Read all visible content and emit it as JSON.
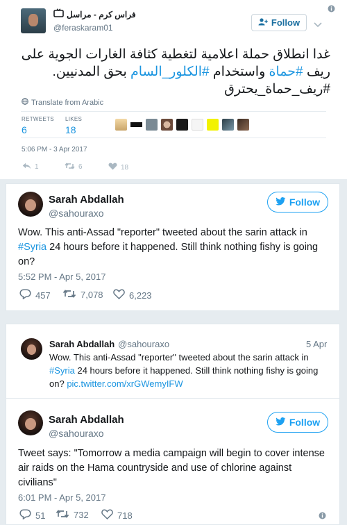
{
  "top_tweet": {
    "display_name": "فراس كرم - مراسل",
    "handle": "@feraskaram01",
    "follow_label": "Follow",
    "text_line1": "غدا انطلاق حملة اعلامية لتغطية كثافة الغارات الجوية على",
    "text_line2_a": "ريف ",
    "text_line2_hashtag1": "#حماة",
    "text_line2_b": " واستخدام ",
    "text_line2_hashtag2": "#الكلور_السام",
    "text_line2_c": " بحق المدنيين.",
    "text_line3_hashtag": "#ريف_حماة_يحترق",
    "translate_label": "Translate from Arabic",
    "retweets_label": "RETWEETS",
    "retweets_value": "6",
    "likes_label": "LIKES",
    "likes_value": "18",
    "timestamp": "5:06 PM - 3 Apr 2017",
    "reply_count": "1",
    "retweet_count": "6",
    "like_count": "18"
  },
  "tweet1": {
    "display_name": "Sarah Abdallah",
    "handle": "@sahouraxo",
    "follow_label": "Follow",
    "text_a": "Wow. This anti-Assad \"reporter\" tweeted about the sarin attack in ",
    "hashtag": "#Syria",
    "text_b": " 24 hours before it happened. Still think nothing fishy is going on?",
    "timestamp": "5:52 PM - Apr 5, 2017",
    "reply_count": "457",
    "retweet_count": "7,078",
    "like_count": "6,223"
  },
  "quoted": {
    "display_name": "Sarah Abdallah",
    "handle": "@sahouraxo",
    "date": "5 Apr",
    "text_a": "Wow. This anti-Assad \"reporter\" tweeted about the sarin attack in ",
    "hashtag": "#Syria",
    "text_b": " 24 hours before it happened. Still think nothing fishy is going on? ",
    "link": "pic.twitter.com/xrGWemyIFW"
  },
  "tweet2": {
    "display_name": "Sarah Abdallah",
    "handle": "@sahouraxo",
    "follow_label": "Follow",
    "text": "Tweet says: \"Tomorrow a media campaign will begin to cover intense air raids on the Hama countryside and use of chlorine against civilians\"",
    "timestamp": "6:01 PM - Apr 5, 2017",
    "reply_count": "51",
    "retweet_count": "732",
    "like_count": "718"
  },
  "colors": {
    "accent": "#1da1f2",
    "link": "#1b95e0",
    "muted": "#657786",
    "background": "#e6ecf0"
  },
  "icons": [
    "tv-icon",
    "add-user-icon",
    "chevron-down-icon",
    "info-icon",
    "globe-icon",
    "reply-icon",
    "retweet-icon",
    "heart-icon",
    "twitter-bird-icon"
  ]
}
